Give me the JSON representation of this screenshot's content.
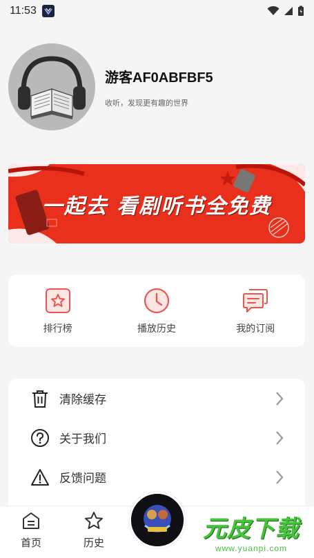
{
  "status_bar": {
    "time": "11:53"
  },
  "profile": {
    "name": "游客AF0ABFBF5",
    "tagline": "收听，发现更有趣的世界",
    "avatar_icon": "headphones-book-icon"
  },
  "banner": {
    "text": "一起去 看剧听书全免费",
    "color": "#e8301c"
  },
  "quick_actions": [
    {
      "label": "排行榜",
      "icon": "star-square-icon"
    },
    {
      "label": "播放历史",
      "icon": "clock-icon"
    },
    {
      "label": "我的订阅",
      "icon": "chat-bubbles-icon"
    }
  ],
  "menu": [
    {
      "label": "清除缓存",
      "icon": "trash-icon"
    },
    {
      "label": "关于我们",
      "icon": "question-circle-icon"
    },
    {
      "label": "反馈问题",
      "icon": "warning-triangle-icon"
    }
  ],
  "bottom_nav": {
    "home": "首页",
    "history": "历史"
  },
  "watermark": {
    "main": "元皮下载",
    "url": "www.yuanpi.com"
  },
  "colors": {
    "accent": "#e8574d",
    "banner_red": "#e8301c",
    "watermark_green": "#46c33b"
  }
}
